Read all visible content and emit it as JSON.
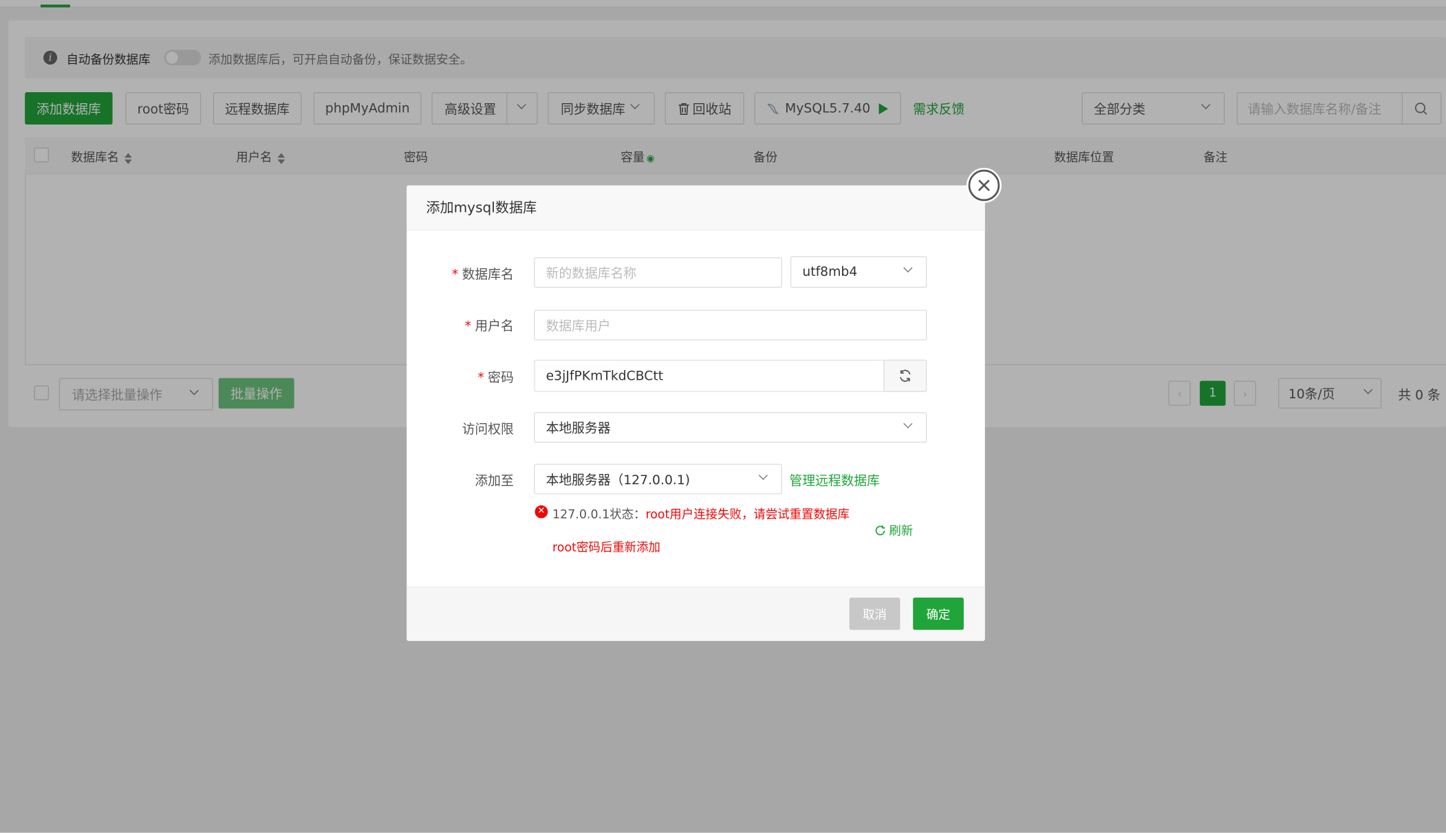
{
  "notice": {
    "label": "自动备份数据库",
    "hint": "添加数据库后，可开启自动备份，保证数据安全。"
  },
  "toolbar": {
    "add_db": "添加数据库",
    "root_pwd": "root密码",
    "remote_db": "远程数据库",
    "phpmyadmin": "phpMyAdmin",
    "advanced": "高级设置",
    "sync_db": "同步数据库",
    "recycle": "回收站",
    "mysql_version": "MySQL5.7.40",
    "feedback": "需求反馈",
    "category": "全部分类",
    "search_placeholder": "请输入数据库名称/备注"
  },
  "table": {
    "headers": [
      "数据库名",
      "用户名",
      "密码",
      "容量",
      "备份",
      "数据库位置",
      "备注"
    ]
  },
  "footer": {
    "batch_placeholder": "请选择批量操作",
    "batch_button": "批量操作",
    "current_page": "1",
    "page_size": "10条/页",
    "total": "共 0 条"
  },
  "dialog": {
    "title": "添加mysql数据库",
    "db_name_label": "数据库名",
    "db_name_placeholder": "新的数据库名称",
    "charset": "utf8mb4",
    "username_label": "用户名",
    "username_placeholder": "数据库用户",
    "password_label": "密码",
    "password_value": "e3jJfPKmTkdCBCtt",
    "access_label": "访问权限",
    "access_value": "本地服务器",
    "add_to_label": "添加至",
    "add_to_value": "本地服务器（127.0.0.1)",
    "manage_remote": "管理远程数据库",
    "status_prefix": "127.0.0.1状态：",
    "status_error_1": "root用户连接失败，请尝试重置数据库",
    "status_error_2": "root密码后重新添加",
    "refresh": "刷新",
    "cancel": "取消",
    "confirm": "确定"
  },
  "colors": {
    "accent": "#20a53a",
    "error": "#ef0808"
  }
}
